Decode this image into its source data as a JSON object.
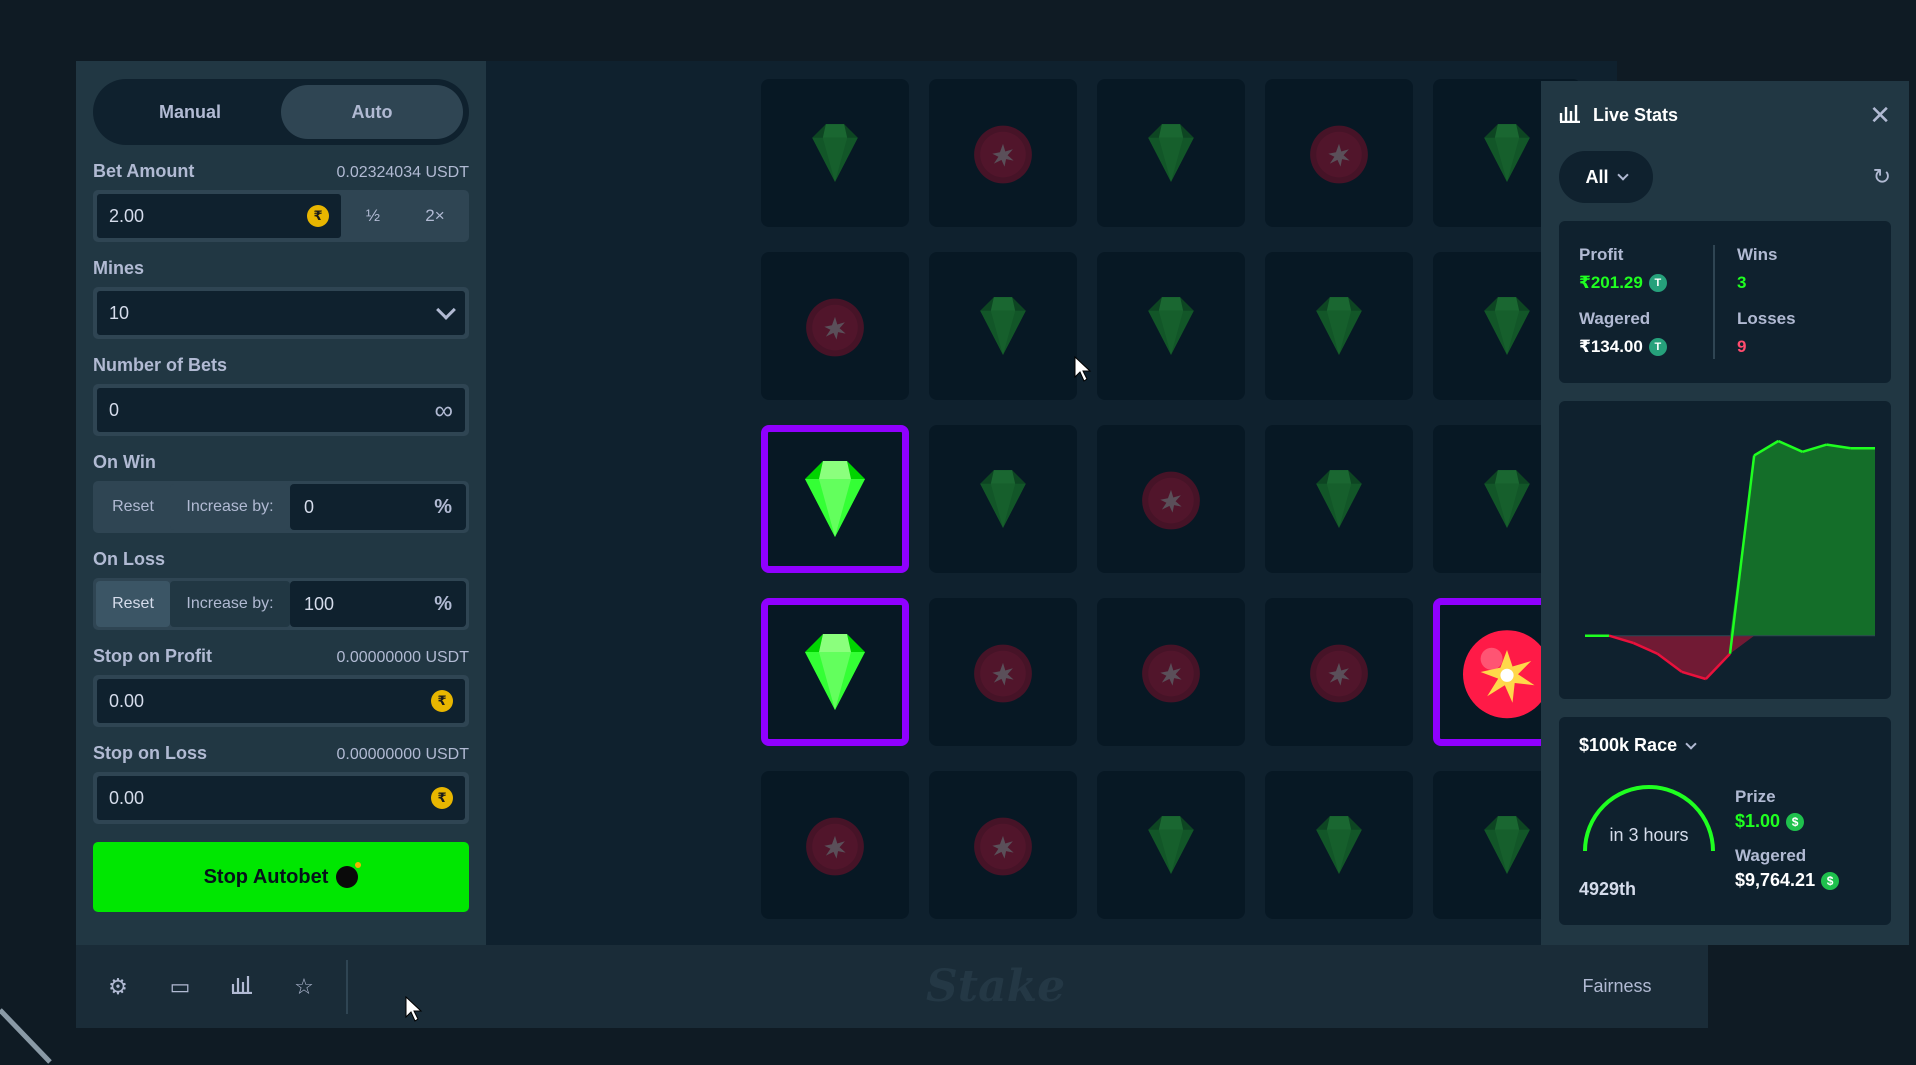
{
  "sidebar": {
    "tabs": [
      {
        "label": "Manual",
        "active": false
      },
      {
        "label": "Auto",
        "active": true
      }
    ],
    "bet_amount": {
      "label": "Bet Amount",
      "sub": "0.02324034 USDT",
      "value": "2.00",
      "half": "½",
      "double": "2×"
    },
    "mines": {
      "label": "Mines",
      "value": "10"
    },
    "number_of_bets": {
      "label": "Number of Bets",
      "value": "0"
    },
    "on_win": {
      "label": "On Win",
      "reset": "Reset",
      "increase": "Increase by:",
      "value": "0",
      "unit": "%",
      "selected": "increase"
    },
    "on_loss": {
      "label": "On Loss",
      "reset": "Reset",
      "increase": "Increase by:",
      "value": "100",
      "unit": "%",
      "selected": "reset"
    },
    "stop_on_profit": {
      "label": "Stop on Profit",
      "sub": "0.00000000 USDT",
      "value": "0.00"
    },
    "stop_on_loss": {
      "label": "Stop on Loss",
      "sub": "0.00000000 USDT",
      "value": "0.00"
    },
    "action_label": "Stop Autobet"
  },
  "board": {
    "tiles": [
      "gem",
      "mine",
      "gem",
      "mine",
      "gem",
      "mine",
      "gem",
      "gem",
      "gem",
      "gem",
      "gem-selected",
      "gem",
      "mine",
      "gem",
      "gem",
      "gem-selected",
      "mine",
      "mine",
      "mine",
      "mine-hit",
      "mine",
      "mine",
      "gem",
      "gem",
      "gem"
    ]
  },
  "live_stats": {
    "title": "Live Stats",
    "filter": "All",
    "profit_label": "Profit",
    "profit": "₹201.29",
    "wagered_label": "Wagered",
    "wagered": "₹134.00",
    "wins_label": "Wins",
    "wins": "3",
    "losses_label": "Losses",
    "losses": "9",
    "profit_chart": {
      "type": "area",
      "points": [
        0,
        0,
        -2,
        -5,
        -10,
        -12,
        -5,
        50,
        54,
        51,
        53,
        52,
        52
      ],
      "colors": {
        "positive": "#1fff20",
        "negative": "#e9113c"
      }
    },
    "race": {
      "title": "$100k Race",
      "time_left": "in 3 hours",
      "rank": "4929th",
      "prize_label": "Prize",
      "prize": "$1.00",
      "wagered_label": "Wagered",
      "wagered": "$9,764.21"
    }
  },
  "footer": {
    "icons": [
      "settings-icon",
      "theatre-mode-icon",
      "live-stats-icon",
      "favourite-star-icon"
    ],
    "brand": "Stake",
    "fairness": "Fairness"
  },
  "colors": {
    "accent_green": "#00e701",
    "selected_tile": "#9000ff",
    "panel": "#213743",
    "board_bg": "#0f212e"
  }
}
